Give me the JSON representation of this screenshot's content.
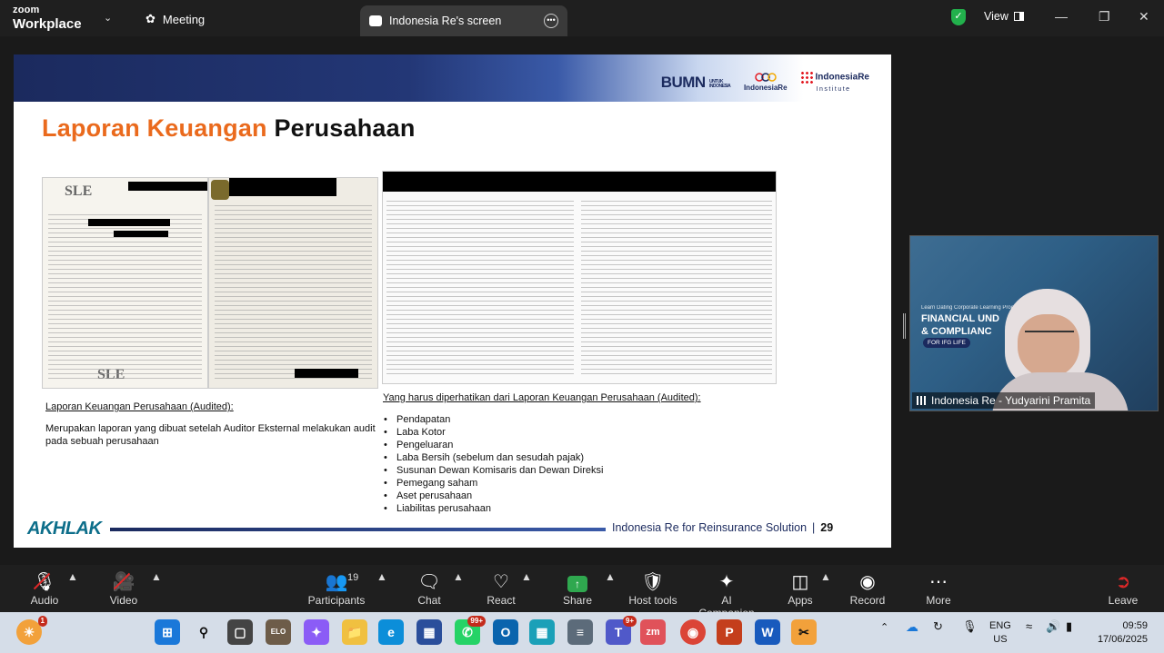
{
  "titlebar": {
    "app_line1": "zoom",
    "app_line2": "Workplace",
    "meeting_label": "Meeting",
    "screen_tab_label": "Indonesia Re's screen",
    "view_label": "View"
  },
  "slide": {
    "title_part1": "Laporan Keuangan",
    "title_part2": "Perusahaan",
    "logo_bumn": "BUMN",
    "logo_bumn_sub": "UNTUK INDONESIA",
    "logo_indonesia_re": "IndonesiaRe",
    "logo_institute_line1": "IndonesiaRe",
    "logo_institute_line2": "Institute",
    "left_heading": "Laporan Keuangan Perusahaan (Audited):",
    "left_paragraph": "Merupakan laporan yang dibuat setelah Auditor Eksternal melakukan audit pada sebuah perusahaan",
    "right_heading": "Yang harus diperhatikan dari Laporan Keuangan Perusahaan (Audited):",
    "bullets": [
      "Pendapatan",
      "Laba Kotor",
      "Pengeluaran",
      "Laba Bersih (sebelum dan sesudah pajak)",
      "Susunan Dewan Komisaris dan Dewan Direksi",
      "Pemegang saham",
      "Aset perusahaan",
      "Liabilitas perusahaan"
    ],
    "doc_logo_text": "SLE",
    "footer_brand": "AKHLAK",
    "footer_text": "Indonesia Re for Reinsurance Solution",
    "footer_separator": "|",
    "page_number": "29"
  },
  "video": {
    "banner_line1": "FINANCIAL UND",
    "banner_line2": "& COMPLIANC",
    "banner_small": "Learn Dating Corporate Learning Prog",
    "chip": "FOR IFG LIFE",
    "participant_name": "Indonesia Re - Yudyarini Pramita"
  },
  "toolbar": {
    "items": [
      {
        "label": "Audio"
      },
      {
        "label": "Video"
      },
      {
        "label": "Participants"
      },
      {
        "label": "Chat"
      },
      {
        "label": "React"
      },
      {
        "label": "Share"
      },
      {
        "label": "Host tools"
      },
      {
        "label": "AI Companion"
      },
      {
        "label": "Apps"
      },
      {
        "label": "Record"
      },
      {
        "label": "More"
      },
      {
        "label": "Leave"
      }
    ],
    "participants_count": "19"
  },
  "taskbar": {
    "weather_badge": "1",
    "whatsapp_badge": "99+",
    "teams_badge": "9+",
    "lang_line1": "ENG",
    "lang_line2": "US",
    "time": "09:59",
    "date": "17/06/2025"
  },
  "colors": {
    "accent_orange": "#ea6a1d",
    "brand_navy": "#1b2a5e",
    "share_green": "#2fa84f",
    "mute_red": "#e02828"
  }
}
